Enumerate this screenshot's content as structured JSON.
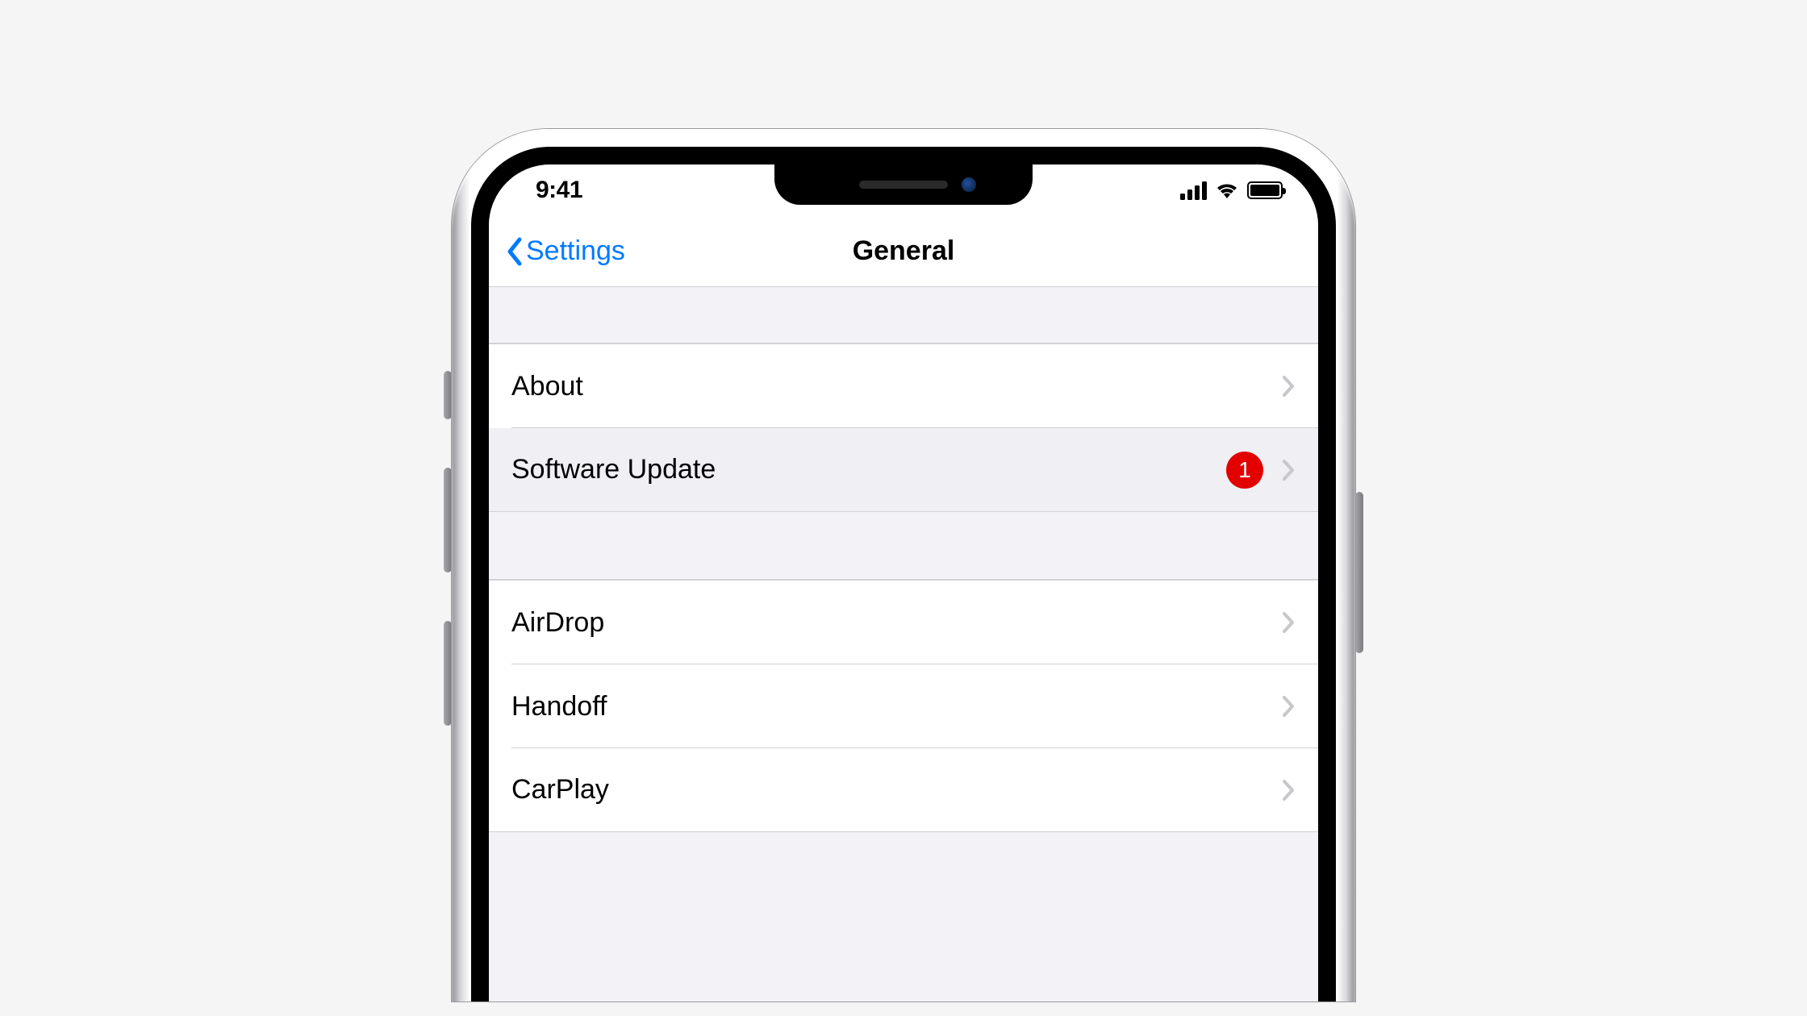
{
  "statusBar": {
    "time": "9:41"
  },
  "navBar": {
    "back": "Settings",
    "title": "General"
  },
  "group1": [
    {
      "label": "About",
      "badge": null,
      "highlighted": false
    },
    {
      "label": "Software Update",
      "badge": "1",
      "highlighted": true
    }
  ],
  "group2": [
    {
      "label": "AirDrop",
      "badge": null
    },
    {
      "label": "Handoff",
      "badge": null
    },
    {
      "label": "CarPlay",
      "badge": null
    }
  ],
  "colors": {
    "tint": "#007aff",
    "badge": "#e30000"
  }
}
